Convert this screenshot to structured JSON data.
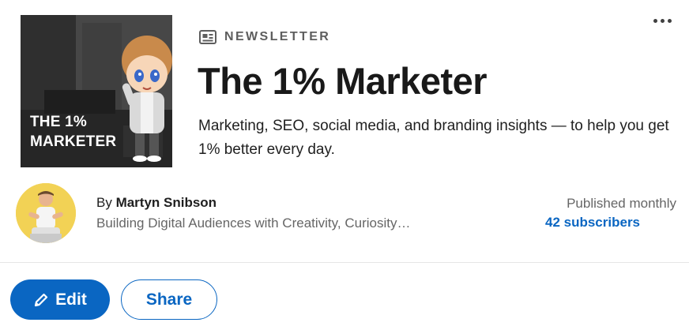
{
  "menu": {
    "icon": "more-horizontal-icon"
  },
  "cover": {
    "text_line1": "THE 1%",
    "text_line2": "MARKETER"
  },
  "newsletter": {
    "label": "NEWSLETTER",
    "label_icon": "newsletter-icon",
    "title": "The 1% Marketer",
    "description": "Marketing, SEO, social media, and branding insights — to help you get 1% better every day."
  },
  "author": {
    "by": "By ",
    "name": "Martyn Snibson",
    "headline": "Building Digital Audiences with Creativity, Curiosity…"
  },
  "stats": {
    "cadence": "Published monthly",
    "subscribers": "42 subscribers"
  },
  "actions": {
    "edit_label": "Edit",
    "edit_icon": "pencil-icon",
    "share_label": "Share"
  },
  "colors": {
    "accent": "#0a66c2",
    "avatar_bg": "#f2d255"
  }
}
